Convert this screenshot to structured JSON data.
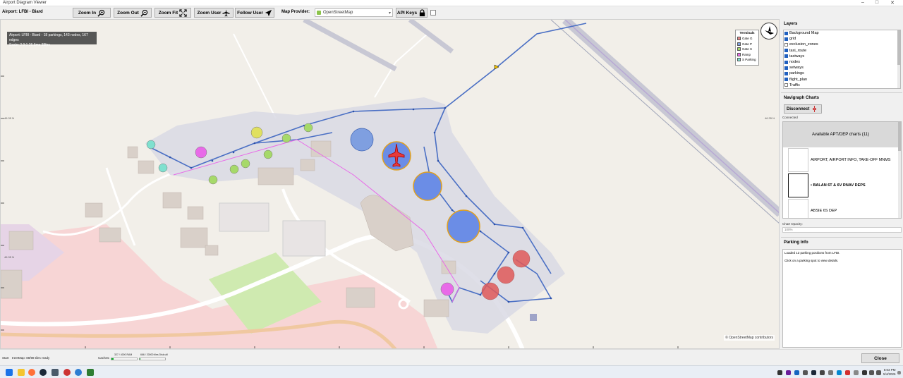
{
  "window": {
    "title": "Airport Diagram Viewer"
  },
  "toolbar": {
    "airport_label": "Airport: LFBI - Biard",
    "zoom_in": "Zoom In",
    "zoom_out": "Zoom Out",
    "zoom_fit": "Zoom Fit",
    "zoom_user": "Zoom User",
    "follow_user": "Follow User",
    "map_provider_label": "Map Provider:",
    "map_provider_value": "OpenStreetMap",
    "api_keys": "API Keys"
  },
  "map": {
    "info_line1": "Airport: LFBI - Biard - 18 parkings, 143 nodes, 167 edges",
    "info_line2": "Scale: 2.9:1 26.6ms 38fps",
    "attribution": "© OpenStreetMap contributors",
    "lat_labels": [
      "46.35 N",
      "46.35 N",
      "46.35 N"
    ],
    "legend": {
      "title": "Terminals",
      "items": [
        {
          "label": "Gate G",
          "color": "#e88a8a"
        },
        {
          "label": "Gate P",
          "color": "#7f9fe0"
        },
        {
          "label": "Gate S",
          "color": "#a6d96a"
        },
        {
          "label": "Ramp",
          "color": "#e86ae8"
        },
        {
          "label": "S Parking",
          "color": "#7fe0cf"
        }
      ]
    },
    "colors": {
      "apron": "#d9d9e4",
      "taxi": "#4a6fc4",
      "gate_g": "#e05a5a",
      "gate_p": "#6b8de6",
      "gate_s": "#a6d96a",
      "ramp": "#e86ae8",
      "s_parking": "#7fe0cf",
      "residential": "#f7d5d5"
    }
  },
  "layers": {
    "title": "Layers",
    "items": [
      {
        "label": "Background Map",
        "checked": true
      },
      {
        "label": "grid",
        "checked": true
      },
      {
        "label": "exclusion_zones",
        "checked": false
      },
      {
        "label": "taxi_route",
        "checked": true
      },
      {
        "label": "taxiways",
        "checked": true
      },
      {
        "label": "nodes",
        "checked": true
      },
      {
        "label": "setways",
        "checked": true
      },
      {
        "label": "parkings",
        "checked": true
      },
      {
        "label": "flight_plan",
        "checked": true
      },
      {
        "label": "Traffic",
        "checked": false
      }
    ]
  },
  "navigraph": {
    "title": "Navigraph Charts",
    "disconnect": "Disconnect",
    "status": "Connected",
    "header": "Available APT/DEP charts (11)",
    "charts": [
      {
        "label": "AIRPORT, AIRPORT INFO, TAKE-OFF MNMS",
        "selected": false
      },
      {
        "label": "• BALAN 6T & 6V RNAV DEPS",
        "selected": true
      },
      {
        "label": "ABSIE 6S DEP",
        "selected": false
      }
    ],
    "opacity_label": "Chart Opacity:",
    "opacity_value": "100%"
  },
  "parking": {
    "title": "Parking Info",
    "line1": "Loaded 13 parking positions from LFBI.",
    "line2": "Click on a parking spot to view details."
  },
  "footer": {
    "close": "Close",
    "start": "Start",
    "tiles": "treetMap: 88/98 tiles ready",
    "caches": "Caches:",
    "cache1": "327 / 4000 RAM",
    "cache1_pct": 8,
    "cache2": "666 / 20000 tiles Disk util",
    "cache2_pct": 3
  },
  "taskbar": {
    "time": "6:03 PM",
    "date": "5/4/2026"
  }
}
